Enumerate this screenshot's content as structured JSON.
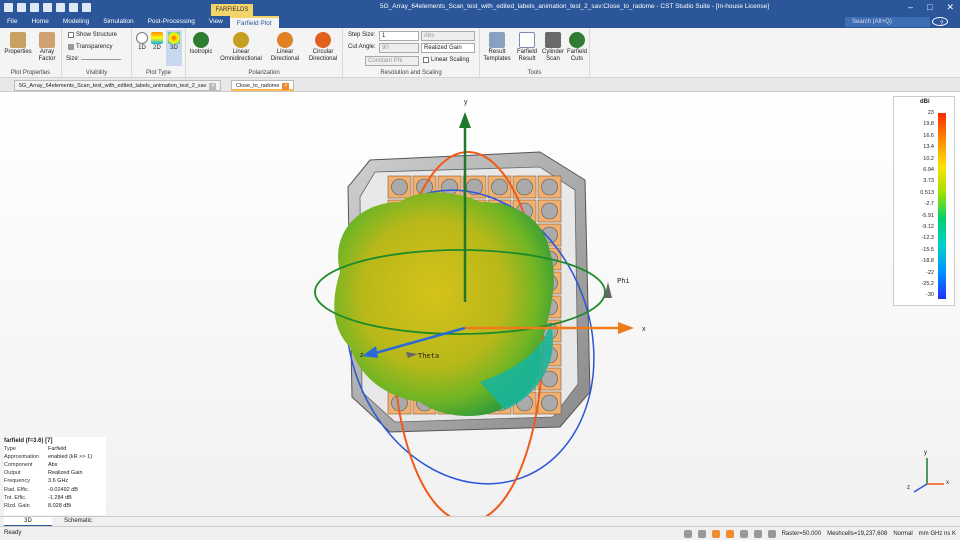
{
  "window": {
    "title": "5G_Array_64elements_Scan_test_with_edited_labels_animation_test_2_sav:Close_to_radome - CST Studio Suite - [In-house License]",
    "context_tab": "FARFIELDS"
  },
  "menu": [
    "File",
    "Home",
    "Modeling",
    "Simulation",
    "Post-Processing",
    "View",
    "Farfield Plot"
  ],
  "search": {
    "placeholder": "Search (Alt+Q)"
  },
  "ribbon": {
    "plot_properties": {
      "label": "Plot Properties",
      "properties": "Properties",
      "array_factor": "Array Factor"
    },
    "visibility": {
      "label": "Visibility",
      "show_structure": "Show Structure",
      "transparency": "Transparency",
      "size": "Size:"
    },
    "plot_type": {
      "label": "Plot Type",
      "b1d": "1D",
      "b2d": "2D",
      "b3d": "3D"
    },
    "polarization": {
      "label": "Polarization",
      "isotropic": "Isotropic",
      "linear_omni": "Linear Omnidirectional",
      "linear_dir": "Linear Directional",
      "circular_dir": "Circular Directional"
    },
    "resolution": {
      "label": "Resolution and Scaling",
      "step_size": "Step Size:",
      "step_value": "1",
      "cut_angle": "Cut Angle:",
      "cut_value": "90",
      "abs": "Abs",
      "realized_gain": "Realized Gain",
      "constant_phi": "Constant Phi",
      "linear_scaling": "Linear Scaling"
    },
    "tools": {
      "label": "Tools",
      "result_templates": "Result Templates",
      "farfield_result": "Farfield Result",
      "cylinder_scan": "Cylinder Scan",
      "farfield_cuts": "Farfield Cuts"
    }
  },
  "doc_tabs": [
    "5G_Array_64elements_Scan_test_with_edited_labels_animation_test_2_sav",
    "Close_to_radome"
  ],
  "axes": {
    "y": "y",
    "x": "x",
    "z": "z",
    "phi": "Phi",
    "theta": "Theta"
  },
  "legend": {
    "unit": "dBi",
    "ticks": [
      "23",
      "19.8",
      "16.6",
      "13.4",
      "10.2",
      "6.94",
      "3.73",
      "0.513",
      "-2.7",
      "-5.91",
      "-9.12",
      "-12.3",
      "-15.5",
      "-18.8",
      "-22",
      "-25.2",
      "-30"
    ]
  },
  "info": {
    "title": "farfield (f=3.6) [7]",
    "rows": [
      [
        "Type",
        "Farfield"
      ],
      [
        "Approximation",
        "enabled (kR >> 1)"
      ],
      [
        "Component",
        "Abs"
      ],
      [
        "Output",
        "Realized Gain"
      ],
      [
        "Frequency",
        "3.6 GHz"
      ],
      [
        "Rad. Effic.",
        "-0.02492 dB"
      ],
      [
        "Tot. Effic.",
        "-1.284 dB"
      ],
      [
        "Rlzd. Gain",
        "8.028 dBi"
      ]
    ]
  },
  "bottom_tabs": [
    "3D",
    "Schematic"
  ],
  "status": {
    "ready": "Ready",
    "raster": "Raster=50.000",
    "meshcells": "Meshcells=19,237,608",
    "mode": "Normal",
    "units": "mm  GHz  ns  K"
  }
}
